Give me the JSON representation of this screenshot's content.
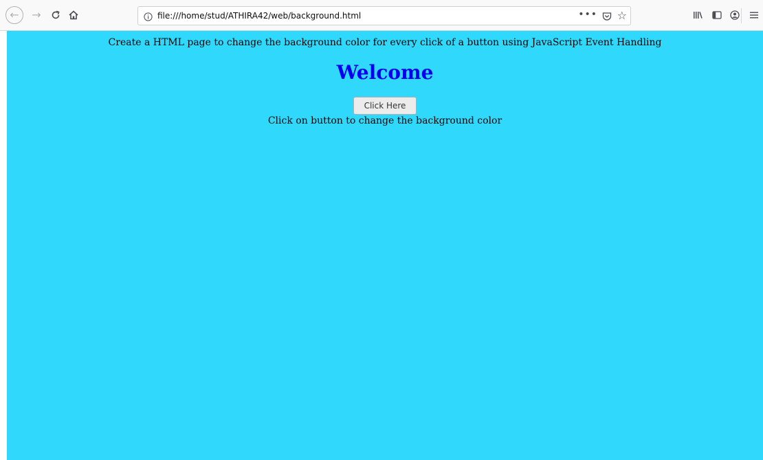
{
  "browser": {
    "url": "file:///home/stud/ATHIRA42/web/background.html",
    "icons": {
      "back": "back-arrow-icon",
      "forward": "forward-arrow-icon",
      "reload": "reload-icon",
      "home": "home-icon",
      "info": "info-icon",
      "more": "more-actions-icon",
      "pocket": "pocket-icon",
      "star": "bookmark-star-icon",
      "library": "library-icon",
      "sidebar": "sidebar-icon",
      "account": "account-icon",
      "menu": "hamburger-menu-icon"
    }
  },
  "page": {
    "background_color": "#30d9fc",
    "intro": "Create a HTML page to change the background color for every click of a button using JavaScript Event Handling",
    "heading": "Welcome",
    "heading_color": "#0000ee",
    "button_label": "Click Here",
    "hint": "Click on button to change the background color"
  }
}
